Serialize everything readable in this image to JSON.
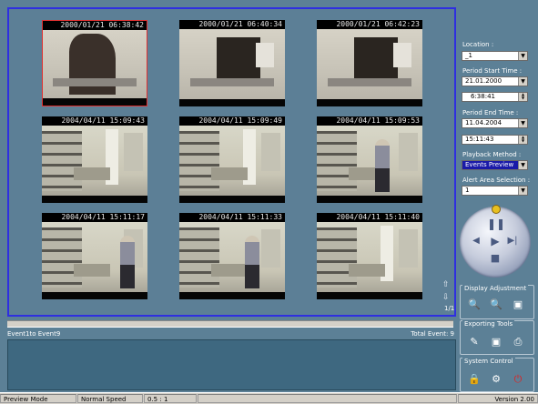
{
  "cameras": [
    {
      "timestamp": "2000/01/21 06:38:42"
    },
    {
      "timestamp": "2000/01/21 06:40:34"
    },
    {
      "timestamp": "2000/01/21 06:42:23"
    },
    {
      "timestamp": "2004/04/11 15:09:43"
    },
    {
      "timestamp": "2004/04/11 15:09:49"
    },
    {
      "timestamp": "2004/04/11 15:09:53"
    },
    {
      "timestamp": "2004/04/11 15:11:17"
    },
    {
      "timestamp": "2004/04/11 15:11:33"
    },
    {
      "timestamp": "2004/04/11 15:11:40"
    }
  ],
  "page_indicator": "1/1",
  "sidebar": {
    "location_label": "Location :",
    "location_value": "_1",
    "start_label": "Period Start Time :",
    "start_date": "21.01.2000",
    "start_time": "6:38:41",
    "end_label": "Period End Time :",
    "end_date": "11.04.2004",
    "end_time": "15:11:43",
    "method_label": "Playback Method :",
    "method_value": "Events Preview",
    "alert_label": "Alert Area Selection :",
    "alert_value": "1"
  },
  "sections": {
    "display": "Display Adjustment",
    "export": "Exporting Tools",
    "system": "System Control"
  },
  "events": {
    "range": "Event1to Event9",
    "total": "Total Event: 9"
  },
  "status": {
    "mode": "Preview Mode",
    "speed": "Normal Speed",
    "ratio": "0.5 : 1",
    "version": "Version 2.00"
  },
  "colors": {
    "background": "#5c8096",
    "viewer_border": "#2f2fe0",
    "selected_cell_border": "#e03030"
  }
}
